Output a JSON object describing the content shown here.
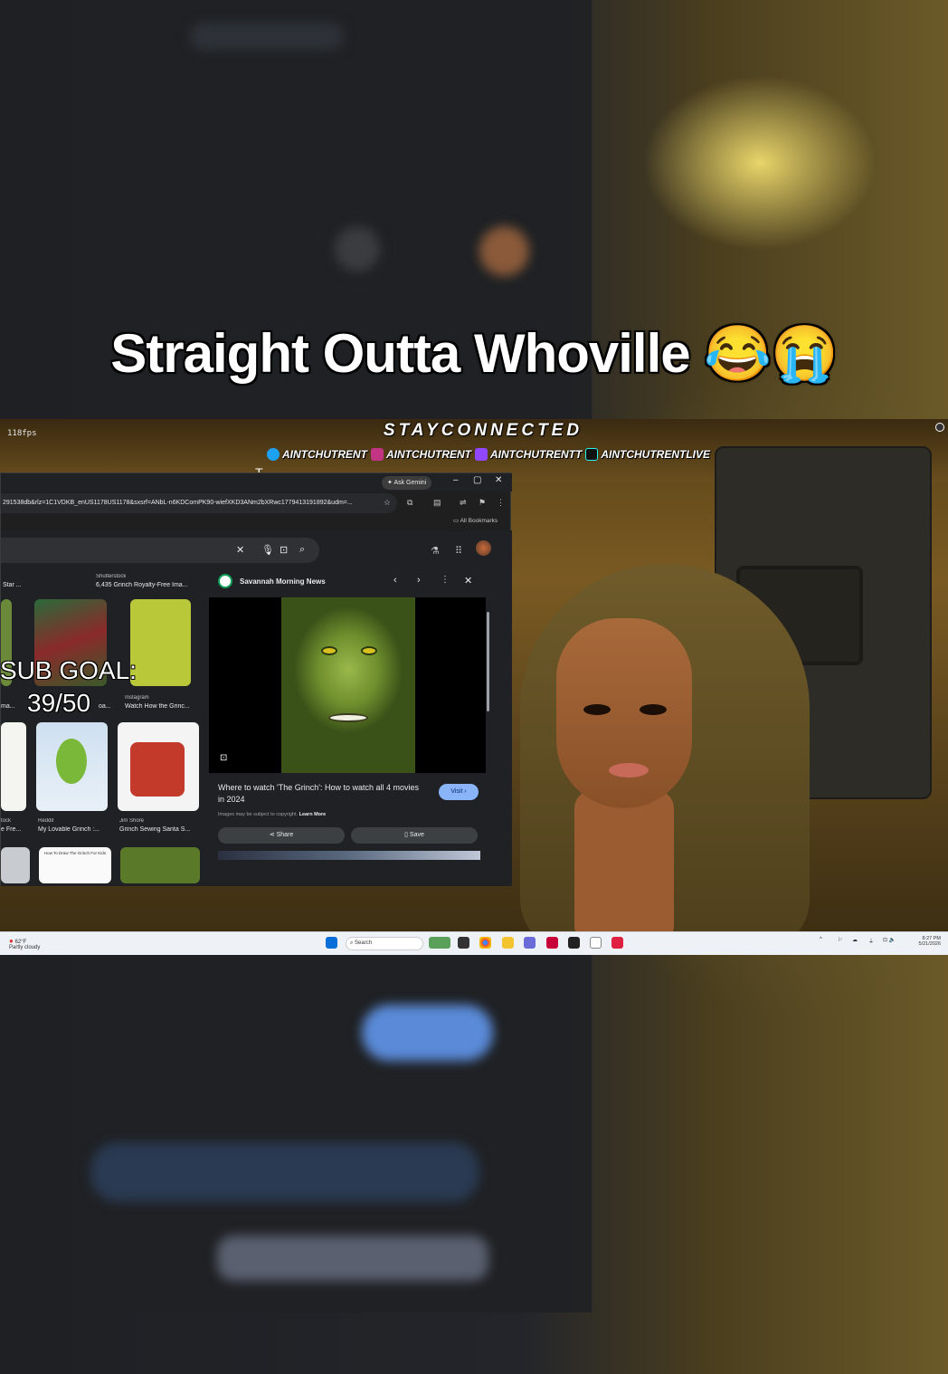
{
  "caption": "Straight Outta Whoville 😂😭",
  "overlay": {
    "fps": "118fps",
    "header": "STAYCONNECTED",
    "socials": [
      {
        "platform": "twitter-icon",
        "handle": "AINTCHUTRENT",
        "color": "#1da1f2"
      },
      {
        "platform": "instagram-icon",
        "handle": "AINTCHUTRENT",
        "color": "#c13584"
      },
      {
        "platform": "twitch-icon",
        "handle": "AINTCHUTRENTT",
        "color": "#9146ff"
      },
      {
        "platform": "tiktok-icon",
        "handle": "AINTCHUTRENTLIVE",
        "color": "#111111"
      }
    ],
    "sub_goal_label": "SUB GOAL:",
    "sub_goal_value": "39/50"
  },
  "browser": {
    "ask_gemini": "Ask Gemini",
    "address": "291538db&rlz=1C1VDKB_enUS1178US1178&sxsrf=ANbL-n6KDComPK90-wiefXKD3ANm2bXRwc1779413191892&udm=...",
    "bookmarks": "All Bookmarks",
    "results": [
      {
        "source": "Shutterstock",
        "title": "6,435 Grinch Royalty-Free Ima..."
      },
      {
        "source": "Star ...",
        "title": ""
      },
      {
        "source": "Instagram",
        "title": "Watch How the Grinc..."
      },
      {
        "source": "ma...",
        "title": ""
      },
      {
        "source": "Reddit",
        "title": "My Lovable Grinch :..."
      },
      {
        "source": "Jim Shore",
        "title": "Grinch Sewing Santa S..."
      },
      {
        "source": "tock",
        "title": "e Fre..."
      },
      {
        "source": "oa...",
        "title": ""
      }
    ],
    "thumb_text": "How To Draw The Grinch For Kids",
    "panel": {
      "source": "Savannah Morning News",
      "title": "Where to watch 'The Grinch': How to watch all 4 movies in 2024",
      "visit": "Visit ›",
      "note": "Images may be subject to copyright.",
      "learn_more": "Learn More",
      "share": "Share",
      "save": "Save"
    }
  },
  "taskbar": {
    "weather_temp": "62°F",
    "weather_desc": "Partly cloudy",
    "search_placeholder": "Search",
    "time": "8:27 PM",
    "date": "5/21/2026"
  }
}
